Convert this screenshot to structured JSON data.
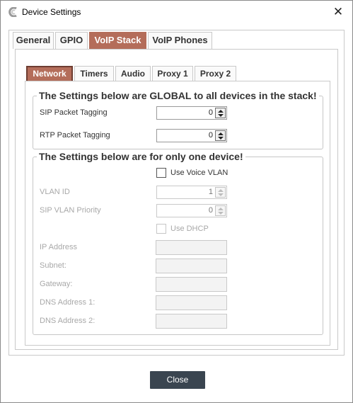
{
  "window": {
    "title": "Device Settings",
    "close_glyph": "✕"
  },
  "outer_tabs": [
    {
      "label": "General"
    },
    {
      "label": "GPIO"
    },
    {
      "label": "VoIP Stack",
      "active": true
    },
    {
      "label": "VoIP Phones"
    }
  ],
  "inner_tabs": [
    {
      "label": "Network",
      "active": true
    },
    {
      "label": "Timers"
    },
    {
      "label": "Audio"
    },
    {
      "label": "Proxy 1"
    },
    {
      "label": "Proxy 2"
    }
  ],
  "global_group": {
    "legend": "The Settings below are GLOBAL to all devices in the stack!",
    "sip_tagging": {
      "label": "SIP Packet Tagging",
      "value": "0"
    },
    "rtp_tagging": {
      "label": "RTP Packet Tagging",
      "value": "0"
    }
  },
  "device_group": {
    "legend": "The Settings below are for only one device!",
    "use_voice_vlan": {
      "label": "Use Voice VLAN",
      "checked": false
    },
    "vlan_id": {
      "label": "VLAN ID",
      "value": "1"
    },
    "sip_vlan_priority": {
      "label": "SIP VLAN Priority",
      "value": "0"
    },
    "use_dhcp": {
      "label": "Use DHCP",
      "checked": false
    },
    "ip_address": {
      "label": "IP Address",
      "value": ""
    },
    "subnet": {
      "label": "Subnet:",
      "value": ""
    },
    "gateway": {
      "label": "Gateway:",
      "value": ""
    },
    "dns1": {
      "label": "DNS Address 1:",
      "value": ""
    },
    "dns2": {
      "label": "DNS Address 2:",
      "value": ""
    }
  },
  "footer": {
    "close_label": "Close"
  },
  "colors": {
    "active_tab": "#b46d5a",
    "close_button": "#3a4550"
  },
  "icons": {
    "app": "app-logo-icon",
    "close": "close-icon",
    "spin": "spinner-arrows-icon"
  }
}
